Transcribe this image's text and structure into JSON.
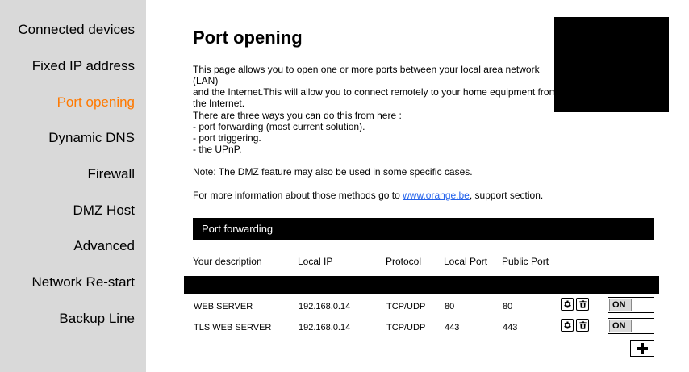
{
  "sidebar": {
    "items": [
      {
        "label": "Connected devices"
      },
      {
        "label": "Fixed IP address"
      },
      {
        "label": "Port opening"
      },
      {
        "label": "Dynamic DNS"
      },
      {
        "label": "Firewall"
      },
      {
        "label": "DMZ Host"
      },
      {
        "label": "Advanced"
      },
      {
        "label": "Network Re-start"
      },
      {
        "label": "Backup Line"
      }
    ],
    "active": "Port opening",
    "active_color": "#ff7900",
    "background": "#d9d9d9"
  },
  "main": {
    "title": "Port opening",
    "intro": "This page allows you to open one or more ports between your local area network (LAN)\nand the Internet.This will allow you to connect remotely to your home equipment from\nthe Internet.",
    "ways": {
      "heading": "There are three ways you can do this from here :",
      "items": [
        "- port forwarding (most current solution).",
        "- port triggering.",
        "- the UPnP."
      ]
    },
    "note": "Note: The DMZ feature may also be used in some specific cases.",
    "more_info": {
      "prefix": "For more information about those methods go to ",
      "link_text": "www.orange.be",
      "suffix": ", support section."
    },
    "link_color": "#2563eb"
  },
  "port_forwarding": {
    "title": "Port forwarding",
    "columns": [
      "Your description",
      "Local IP",
      "Protocol",
      "Local Port",
      "Public Port"
    ],
    "rows": [
      {
        "description": "WEB SERVER",
        "local_ip": "192.168.0.14",
        "protocol": "TCP/UDP",
        "local_port": "80",
        "public_port": "80",
        "toggle": "ON"
      },
      {
        "description": "TLS WEB SERVER",
        "local_ip": "192.168.0.14",
        "protocol": "TCP/UDP",
        "local_port": "443",
        "public_port": "443",
        "toggle": "ON"
      }
    ],
    "icons": {
      "settings": "gear-icon",
      "delete": "trash-icon",
      "add": "plus-icon"
    }
  }
}
